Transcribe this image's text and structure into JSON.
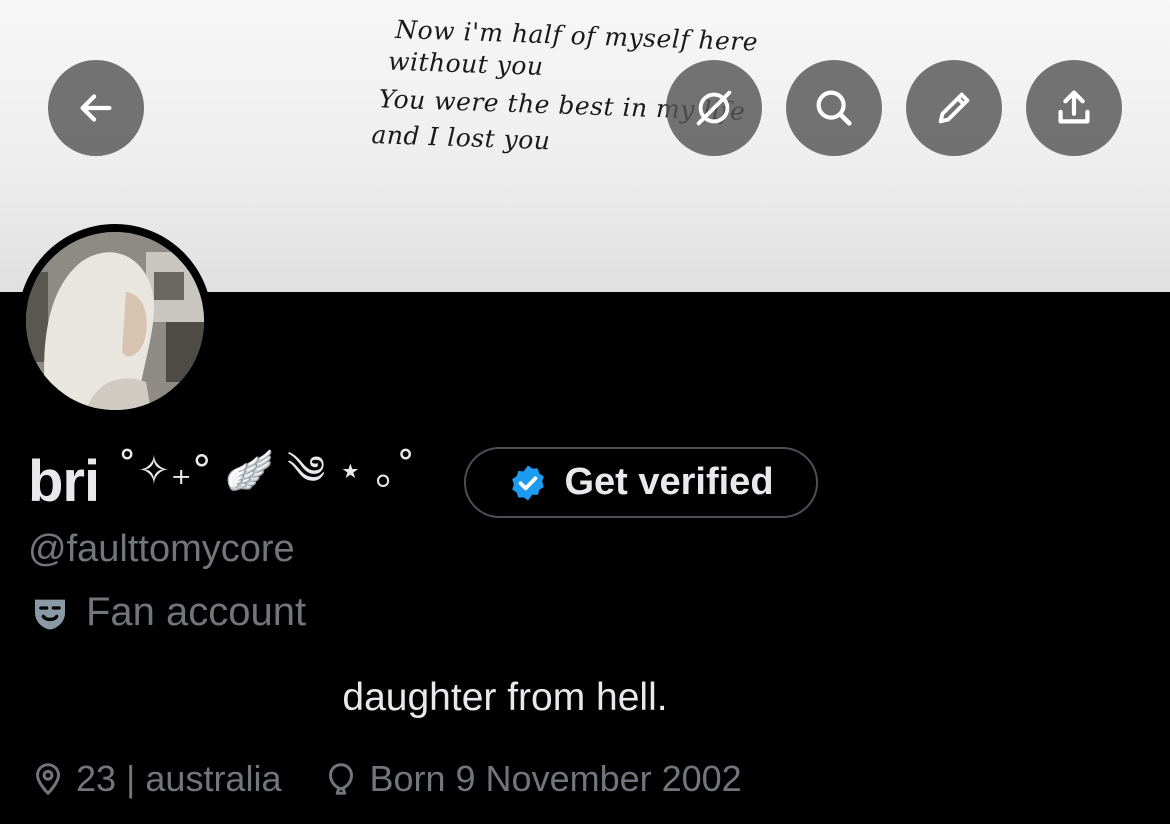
{
  "banner": {
    "lyrics": [
      "Now i'm half of myself here",
      "without you",
      "You were the best in my life",
      "and I lost you"
    ]
  },
  "toolbar": {
    "back_icon": "arrow-left-icon",
    "grok_icon": "grok-icon",
    "search_icon": "search-icon",
    "edit_icon": "pencil-icon",
    "share_icon": "share-icon"
  },
  "profile": {
    "display_name": "bri",
    "name_decoration": "˚✧₊° 🪽 ༄ ⋆ ｡˚",
    "handle": "@faulttomycore",
    "category": "Fan account",
    "bio": "daughter from hell.",
    "location": "23 | australia",
    "birthday": "Born 9 November 2002"
  },
  "verify_button": {
    "label": "Get verified"
  },
  "colors": {
    "background": "#000000",
    "primary_text": "#e7e9ea",
    "secondary_text": "#71767b",
    "verified_blue": "#1d9bf0"
  }
}
